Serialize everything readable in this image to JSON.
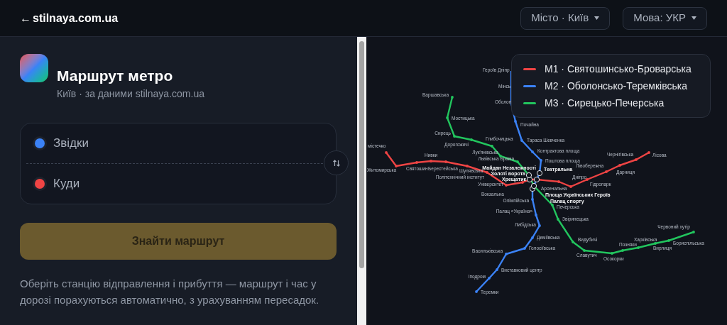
{
  "header": {
    "back_arrow": "←",
    "site": "stilnaya.com.ua",
    "city_button": "Місто · Київ",
    "lang_button": "Мова: УКР"
  },
  "panel": {
    "title": "Маршрут метро",
    "subtitle": "Київ · за даними stilnaya.com.ua",
    "fields": [
      {
        "placeholder": "Звідки",
        "color": "#3b82f6"
      },
      {
        "placeholder": "Куди",
        "color": "#ef4444"
      }
    ],
    "find_button": "Знайти маршрут",
    "hint": "Оберіть станцію відправлення і прибуття — маршрут і час у дорозі порахуються автоматично, з урахуванням пересадок."
  },
  "map": {
    "lines": [
      {
        "name": "M1 · Святошинсько-Броварська",
        "color": "#ef4444",
        "stations": [
          {
            "name": "містечко",
            "kind": "station"
          },
          {
            "name": "Житомирська",
            "kind": "station"
          },
          {
            "name": "Святошин",
            "kind": "station"
          },
          {
            "name": "Нивки",
            "kind": "station"
          },
          {
            "name": "Берестейська",
            "kind": "station"
          },
          {
            "name": "Шулявська",
            "kind": "station"
          },
          {
            "name": "Політехнічний інститут",
            "kind": "station"
          },
          {
            "name": "Вокзальна",
            "kind": "station"
          },
          {
            "name": "Університет",
            "kind": "station"
          },
          {
            "name": "Театральна",
            "kind": "transfer"
          },
          {
            "name": "Хрещатик",
            "kind": "transfer"
          },
          {
            "name": "Арсенальна",
            "kind": "station"
          },
          {
            "name": "Дніпро",
            "kind": "station"
          },
          {
            "name": "Гідропарк",
            "kind": "station"
          },
          {
            "name": "Лівобережна",
            "kind": "station"
          },
          {
            "name": "Дарниця",
            "kind": "station"
          },
          {
            "name": "Чернігівська",
            "kind": "station"
          },
          {
            "name": "Лісова",
            "kind": "station"
          }
        ]
      },
      {
        "name": "M2 · Оболонсько-Теремківська",
        "color": "#3b82f6",
        "stations": [
          {
            "name": "Героїв Дніпр",
            "kind": "covered"
          },
          {
            "name": "Мінсь",
            "kind": "covered"
          },
          {
            "name": "Оболон",
            "kind": "covered"
          },
          {
            "name": "Почайна",
            "kind": "station"
          },
          {
            "name": "Тараса Шевченка",
            "kind": "station"
          },
          {
            "name": "Контрактова площа",
            "kind": "station"
          },
          {
            "name": "Поштова площа",
            "kind": "station"
          },
          {
            "name": "Майдан Незалежності",
            "kind": "transfer"
          },
          {
            "name": "Площа Українських Героїв",
            "kind": "transfer"
          },
          {
            "name": "Олімпійська",
            "kind": "station"
          },
          {
            "name": "Палац «Україна»",
            "kind": "station"
          },
          {
            "name": "Либідська",
            "kind": "station"
          },
          {
            "name": "Деміївська",
            "kind": "station"
          },
          {
            "name": "Голосіївська",
            "kind": "station"
          },
          {
            "name": "Васильківська",
            "kind": "station"
          },
          {
            "name": "Виставковий центр",
            "kind": "station"
          },
          {
            "name": "Іподром",
            "kind": "station"
          },
          {
            "name": "Теремки",
            "kind": "station"
          }
        ]
      },
      {
        "name": "M3 · Сирецько-Печерська",
        "color": "#22c55e",
        "stations": [
          {
            "name": "Варшавська",
            "kind": "station"
          },
          {
            "name": "Мостицька",
            "kind": "station"
          },
          {
            "name": "Сирець",
            "kind": "station"
          },
          {
            "name": "Дорогожичі",
            "kind": "station"
          },
          {
            "name": "Глибочицька",
            "kind": "station"
          },
          {
            "name": "Лук'янівська",
            "kind": "station"
          },
          {
            "name": "Львівська Брама",
            "kind": "station"
          },
          {
            "name": "Золоті ворота",
            "kind": "transfer"
          },
          {
            "name": "Палац спорту",
            "kind": "transfer"
          },
          {
            "name": "Печерська",
            "kind": "station"
          },
          {
            "name": "Звіринецька",
            "kind": "station"
          },
          {
            "name": "Видубичі",
            "kind": "station"
          },
          {
            "name": "Славутич",
            "kind": "station"
          },
          {
            "name": "Осокорки",
            "kind": "station"
          },
          {
            "name": "Позняки",
            "kind": "station"
          },
          {
            "name": "Харківська",
            "kind": "station"
          },
          {
            "name": "Вирлиця",
            "kind": "station"
          },
          {
            "name": "Бориспільська",
            "kind": "station"
          },
          {
            "name": "Червоний хутір",
            "kind": "station"
          }
        ]
      }
    ]
  }
}
